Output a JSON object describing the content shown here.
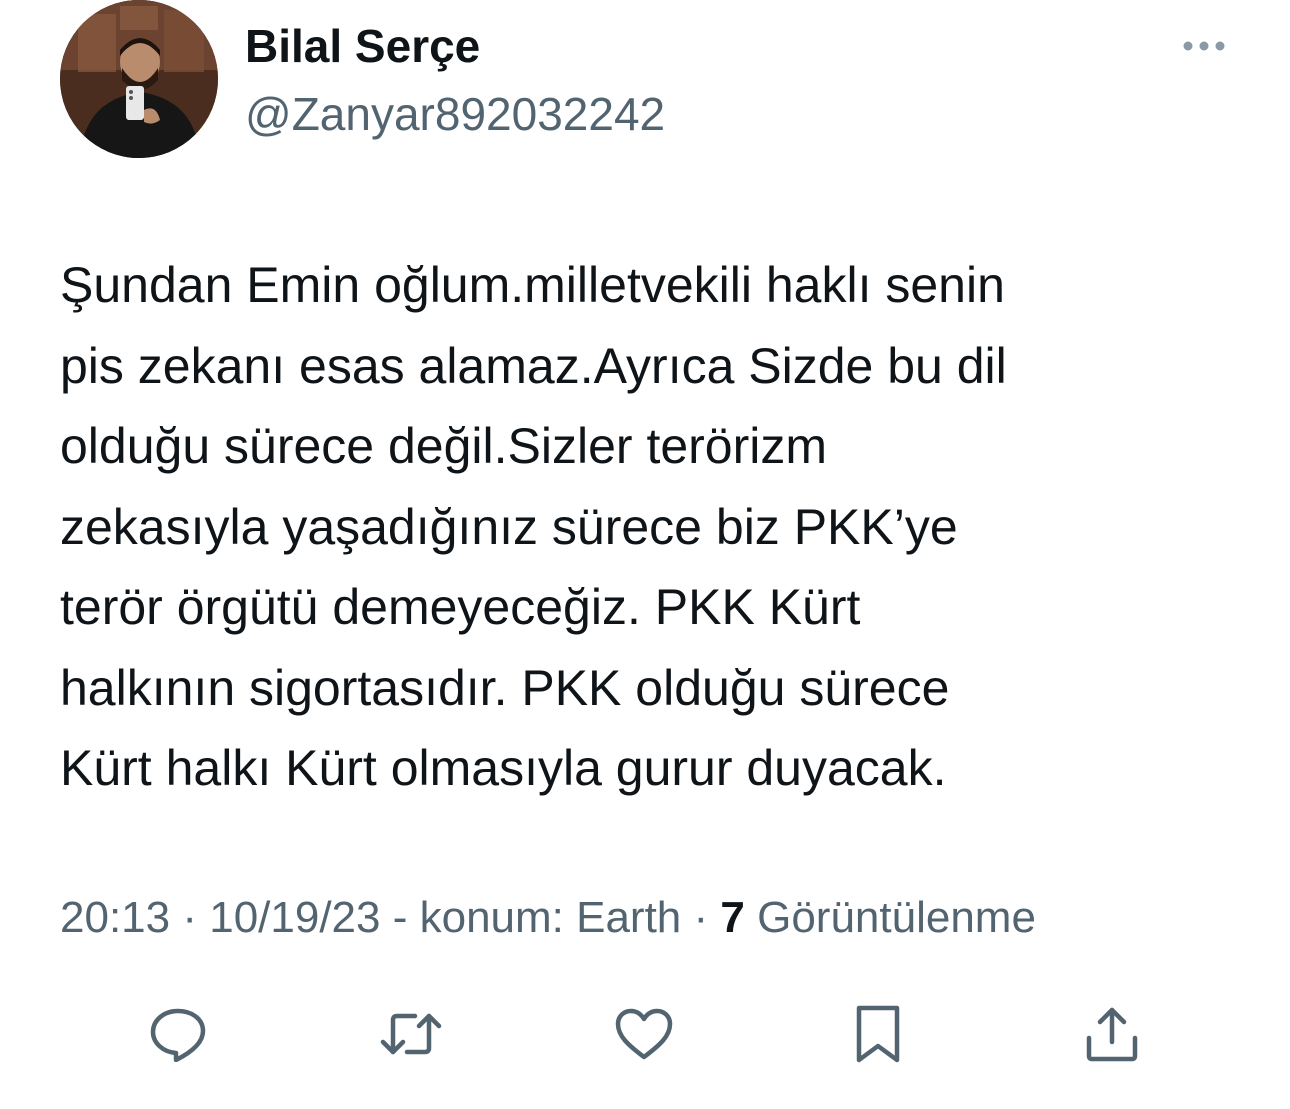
{
  "tweet": {
    "author": {
      "display_name": "Bilal Serçe",
      "handle": "@Zanyar892032242"
    },
    "text": "Şundan Emin oğlum.milletvekili haklı senin\npis zekanı esas alamaz.Ayrıca Sizde bu dil\nolduğu sürece değil.Sizler terörizm\nzekasıyla yaşadığınız sürece biz PKK’ye\nterör örgütü demeyeceğiz. PKK Kürt\nhalkının sigortasıdır. PKK olduğu sürece\nKürt halkı Kürt olmasıyla gurur duyacak.",
    "meta": {
      "time": "20:13",
      "separator": " · ",
      "date": "10/19/23",
      "location_text": " - konum: Earth",
      "separator2": " · ",
      "views_count": "7",
      "views_label": " Görüntülenme"
    }
  },
  "icons": {
    "more": "more-horizontal-icon",
    "reply": "reply-icon",
    "retweet": "retweet-icon",
    "like": "like-icon",
    "bookmark": "bookmark-icon",
    "share": "share-icon"
  },
  "colors": {
    "text_primary": "#0f1419",
    "text_secondary": "#536471",
    "icon": "#536471",
    "background": "#ffffff"
  }
}
